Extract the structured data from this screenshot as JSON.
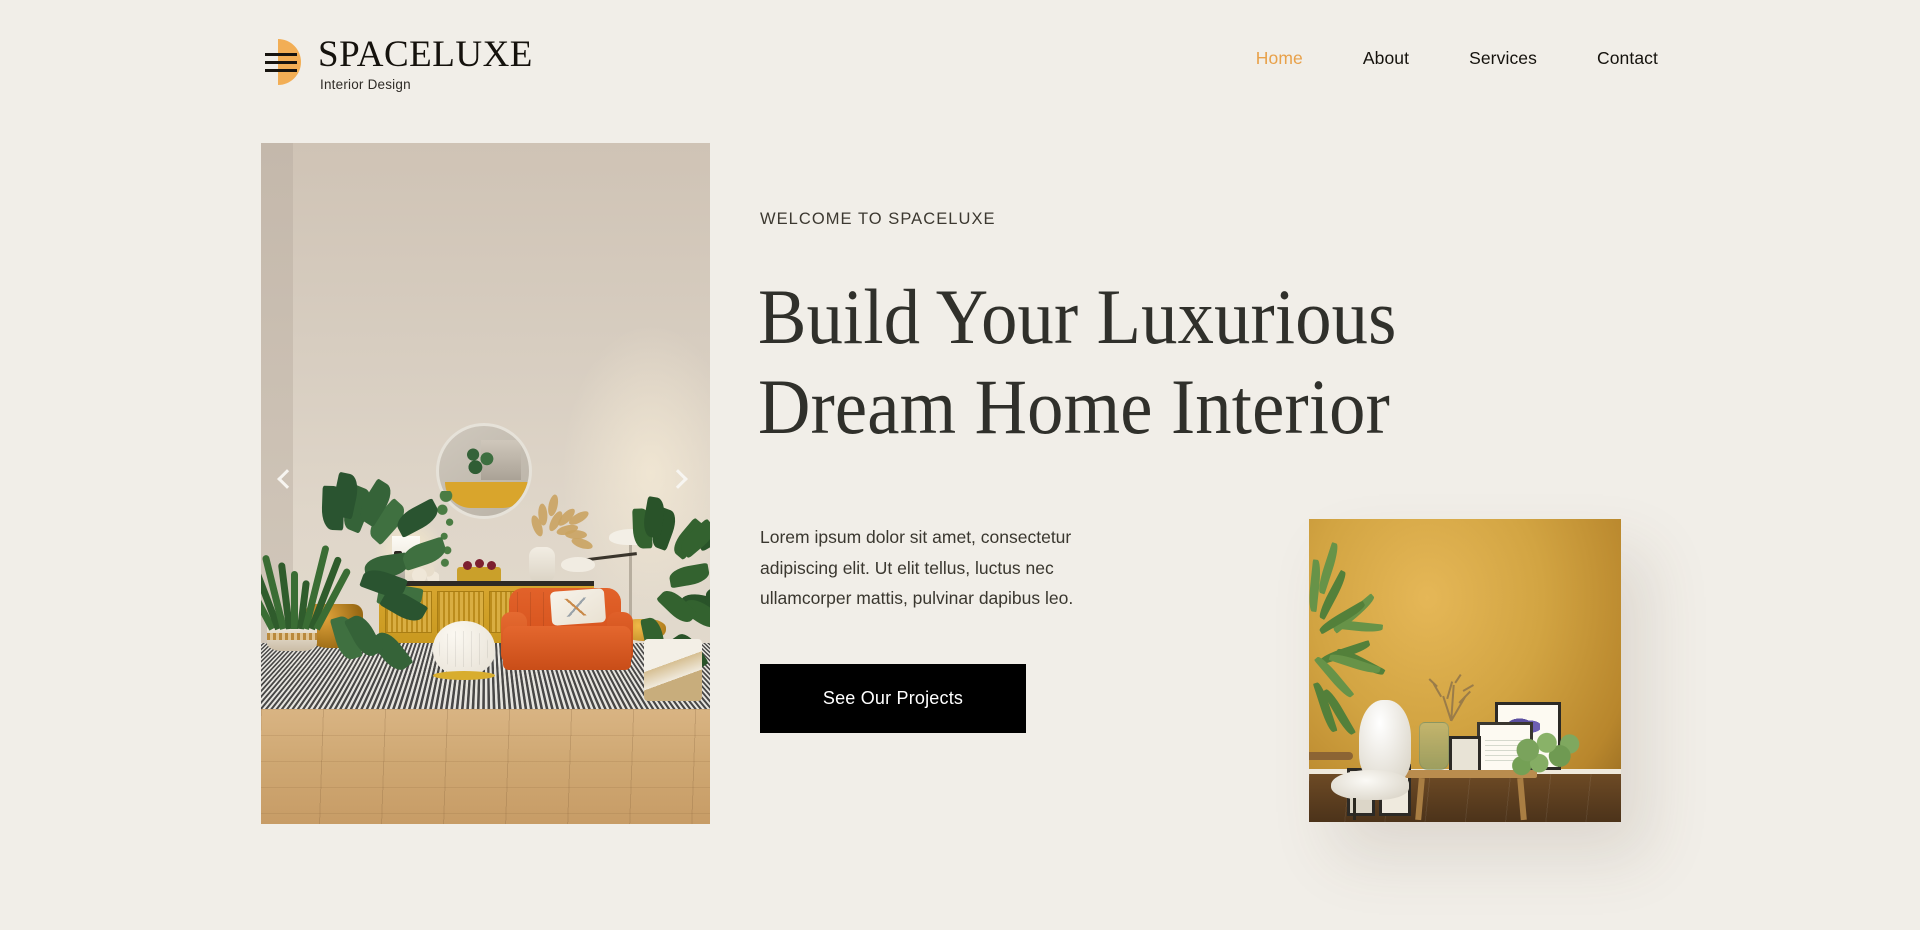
{
  "colors": {
    "page_background": "#f1eee8",
    "accent_orange": "#e8a14a",
    "logo_mark": "#f2ae55",
    "heading": "#30302b",
    "body_text": "#3a372f",
    "cta_background": "#000000",
    "cta_text": "#ffffff"
  },
  "header": {
    "logo": {
      "mark_icon": "hamburger-half-disc-icon",
      "name": "SPACELUXE",
      "tagline": "Interior Design"
    },
    "nav": {
      "items": [
        {
          "label": "Home",
          "active": true
        },
        {
          "label": "About",
          "active": false
        },
        {
          "label": "Services",
          "active": false
        },
        {
          "label": "Contact",
          "active": false
        }
      ]
    }
  },
  "hero": {
    "eyebrow": "WELCOME TO SPACELUXE",
    "headline_line1": "Build Your Luxurious",
    "headline_line2": "Dream Home Interior",
    "paragraph": "Lorem ipsum dolor sit amet, consectetur adipiscing elit. Ut elit tellus, luctus nec ullamcorper mattis, pulvinar dapibus leo.",
    "cta_label": "See Our Projects",
    "slider": {
      "prev_icon": "chevron-left-icon",
      "next_icon": "chevron-right-icon",
      "main_image_alt": "Beige living room with mustard sideboard, round mirror, orange armchair, white pouf, woven rug and large green plants",
      "secondary_image_alt": "Mustard yellow wall room with white sheepskin chair, wooden bench, glass vase with branches, framed artworks and green plant"
    }
  }
}
